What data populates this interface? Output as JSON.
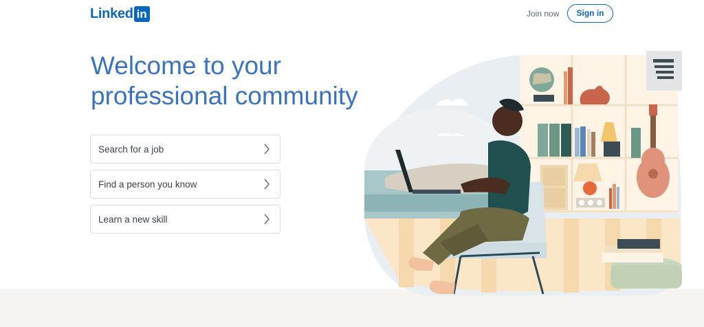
{
  "header": {
    "logo_text": "Linked",
    "logo_box": "in",
    "join_now": "Join now",
    "sign_in": "Sign in"
  },
  "main": {
    "headline_line1": "Welcome to your",
    "headline_line2": "professional community",
    "options": [
      {
        "label": "Search for a job"
      },
      {
        "label": "Find a person you know"
      },
      {
        "label": "Learn a new skill"
      }
    ]
  },
  "colors": {
    "brand": "#0a66c2",
    "headline": "#3a73c3",
    "text": "#38434f",
    "muted": "#56687a",
    "footer_band": "#f6f4f1"
  },
  "icons": {
    "chevron": "chevron-right-icon",
    "illustration": "person-working-on-laptop-illustration"
  }
}
